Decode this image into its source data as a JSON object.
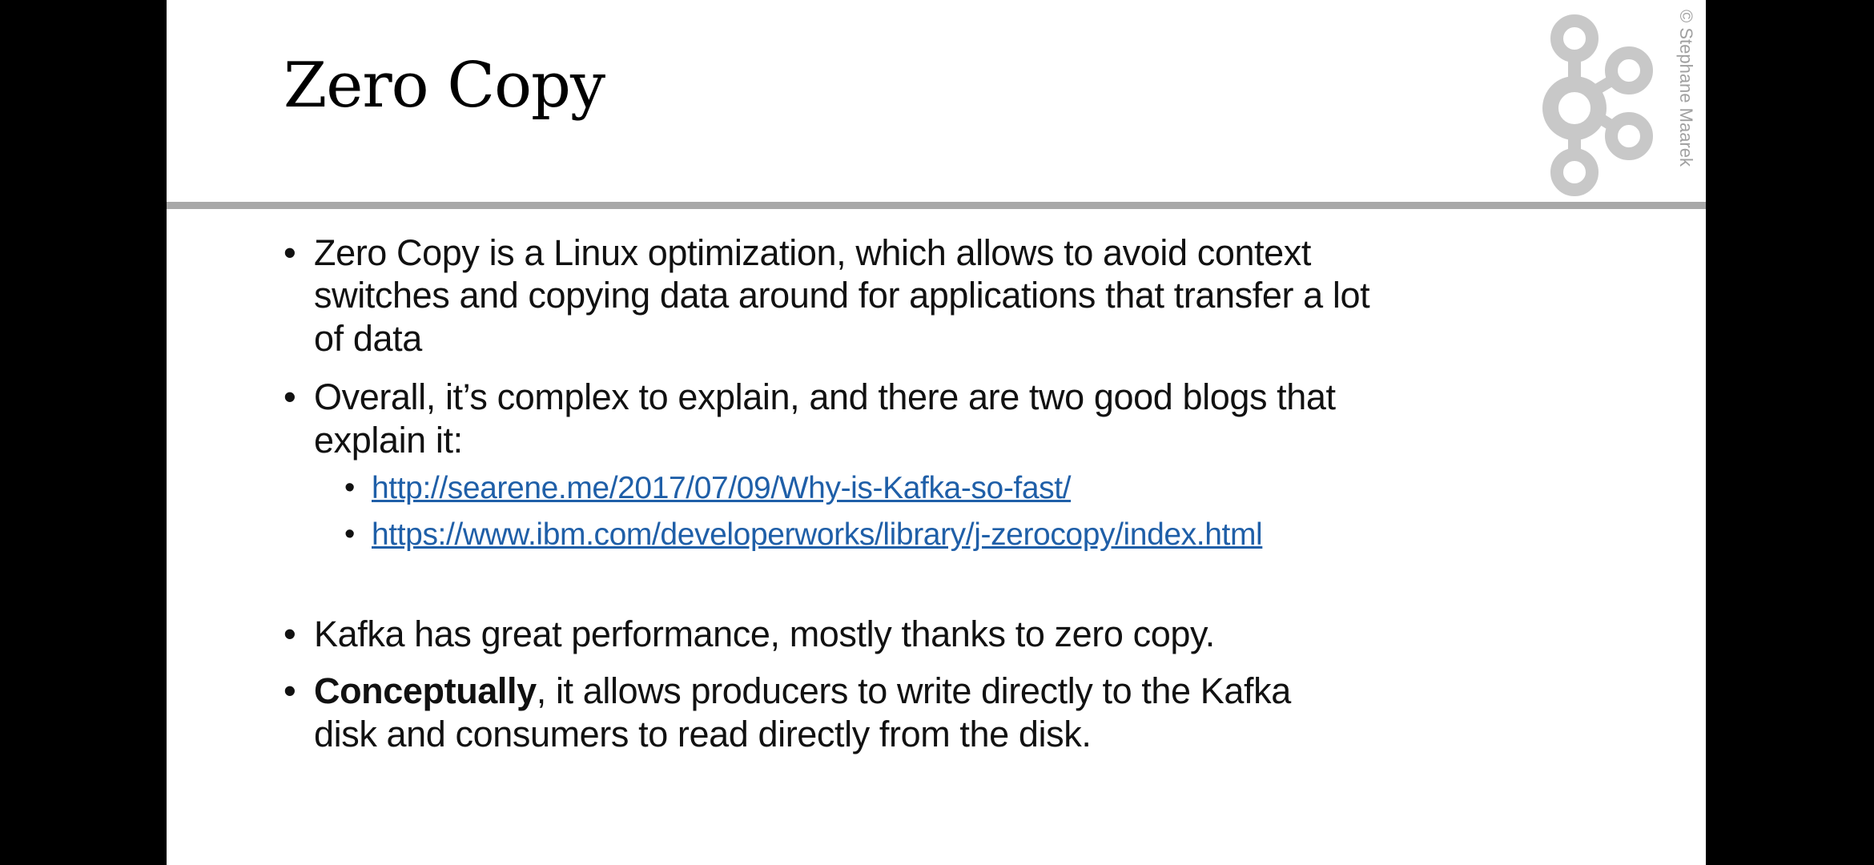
{
  "slide": {
    "title": "Zero Copy",
    "copyright": "© Stephane Maarek",
    "logo_icon": "kafka-logo-icon",
    "bullets": [
      {
        "lines": [
          "Zero Copy is a Linux optimization, which allows to avoid context",
          "switches and copying data around for applications that transfer a lot",
          "of data"
        ]
      },
      {
        "lines": [
          "Overall, it’s complex to explain, and there are two good blogs that",
          "explain it:"
        ],
        "links": [
          "http://searene.me/2017/07/09/Why-is-Kafka-so-fast/",
          "https://www.ibm.com/developerworks/library/j-zerocopy/index.html"
        ]
      },
      {
        "lines": [
          "Kafka has great performance, mostly thanks to zero copy."
        ]
      },
      {
        "bold": "Conceptually",
        "lines": [
          ", it allows producers to write directly to the Kafka",
          "disk and consumers to read directly from the disk."
        ]
      }
    ],
    "colors": {
      "link": "#1f5fa8",
      "rule": "#a8a8a8",
      "logo": "#c8c8c8"
    }
  }
}
